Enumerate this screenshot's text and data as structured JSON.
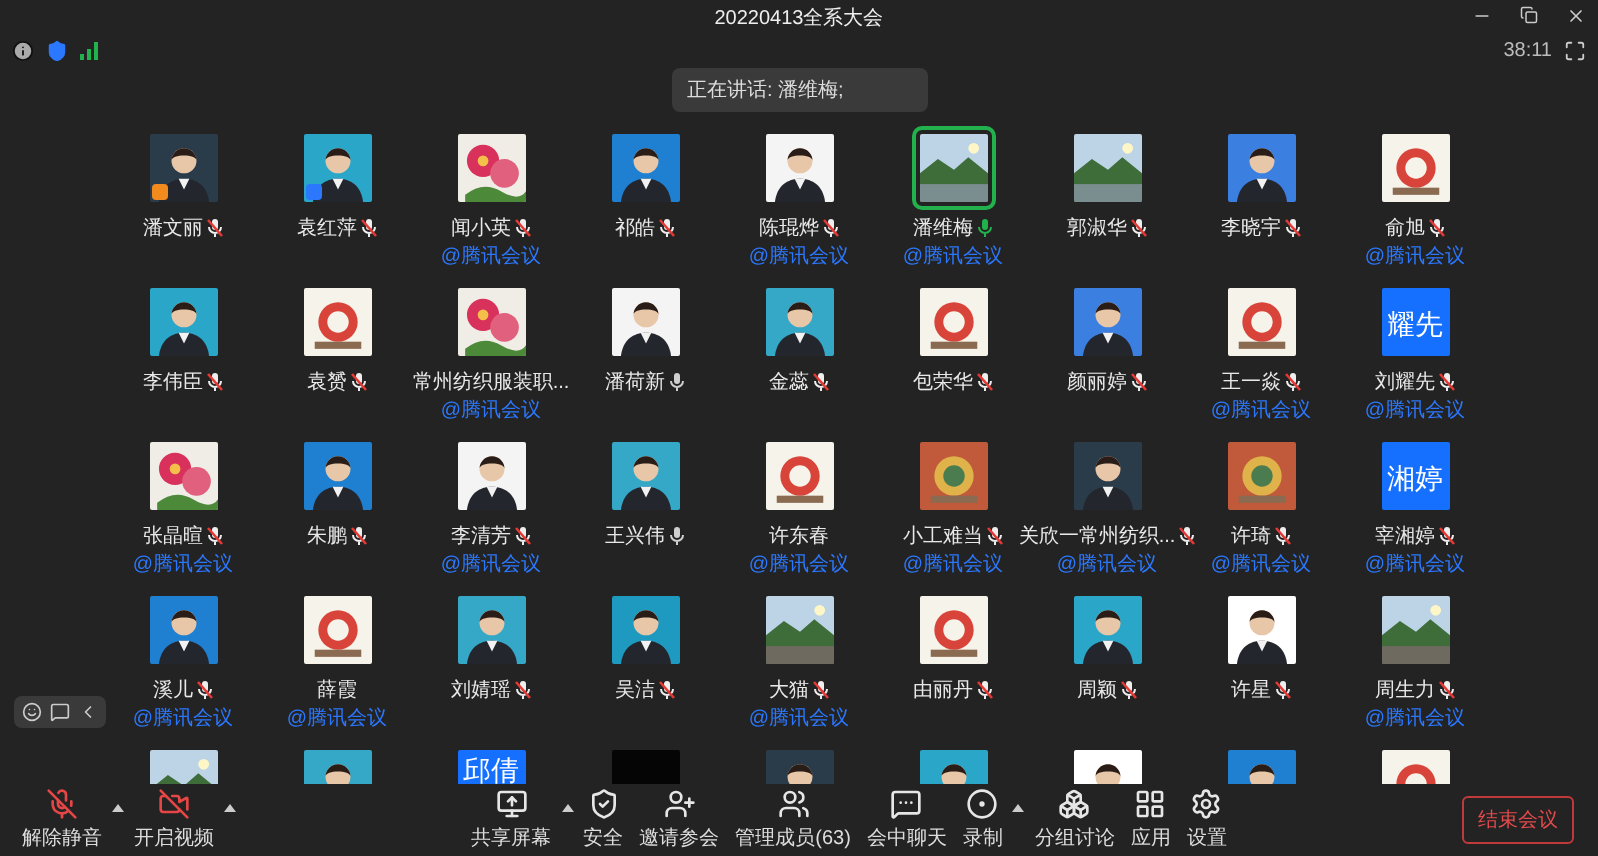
{
  "window": {
    "title": "20220413全系大会",
    "timer": "38:11"
  },
  "speaker_notice": "正在讲话: 潘维梅;",
  "participants": [
    {
      "name": "潘文丽",
      "muted": true,
      "speaking": false,
      "badge": {
        "color": "#f28a1e"
      },
      "active": false
    },
    {
      "name": "袁红萍",
      "muted": true,
      "speaking": false,
      "badge": {
        "color": "#2b78ff"
      },
      "active": false
    },
    {
      "name": "闻小英",
      "muted": true,
      "speaking": false,
      "label": "@腾讯会议",
      "active": false
    },
    {
      "name": "祁皓",
      "muted": true,
      "speaking": false,
      "active": false
    },
    {
      "name": "陈琨烨",
      "muted": true,
      "speaking": false,
      "label": "@腾讯会议",
      "active": false
    },
    {
      "name": "潘维梅",
      "muted": false,
      "speaking": true,
      "label": "@腾讯会议",
      "active": true
    },
    {
      "name": "郭淑华",
      "muted": true,
      "speaking": false,
      "active": false
    },
    {
      "name": "李晓宇",
      "muted": true,
      "speaking": false,
      "active": false
    },
    {
      "name": "俞旭",
      "muted": true,
      "speaking": false,
      "label": "@腾讯会议",
      "active": false
    },
    {
      "name": "李伟臣",
      "muted": true,
      "speaking": false,
      "active": false
    },
    {
      "name": "袁赟",
      "muted": true,
      "speaking": false,
      "active": false
    },
    {
      "name": "常州纺织服装职...",
      "label": "@腾讯会议",
      "active": false
    },
    {
      "name": "潘荷新",
      "muted": false,
      "speaking": false,
      "active": false
    },
    {
      "name": "金蕊",
      "muted": true,
      "speaking": false,
      "active": false
    },
    {
      "name": "包荣华",
      "muted": true,
      "speaking": false,
      "active": false
    },
    {
      "name": "颜丽婷",
      "muted": true,
      "speaking": false,
      "active": false
    },
    {
      "name": "王一焱",
      "muted": true,
      "speaking": false,
      "label": "@腾讯会议",
      "active": false
    },
    {
      "name": "刘耀先",
      "muted": true,
      "speaking": false,
      "label": "@腾讯会议",
      "avatar": {
        "kind": "text",
        "text": "耀先"
      },
      "active": false
    },
    {
      "name": "张晶暄",
      "muted": true,
      "speaking": false,
      "label": "@腾讯会议",
      "active": false
    },
    {
      "name": "朱鹏",
      "muted": true,
      "speaking": false,
      "active": false
    },
    {
      "name": "李清芳",
      "muted": true,
      "speaking": false,
      "label": "@腾讯会议",
      "active": false
    },
    {
      "name": "王兴伟",
      "muted": false,
      "speaking": false,
      "active": false
    },
    {
      "name": "许东春",
      "label": "@腾讯会议",
      "active": false
    },
    {
      "name": "小工难当",
      "muted": true,
      "speaking": false,
      "label": "@腾讯会议",
      "active": false
    },
    {
      "name": "关欣一常州纺织...",
      "muted": true,
      "speaking": false,
      "label": "@腾讯会议",
      "active": false
    },
    {
      "name": "许琦",
      "muted": true,
      "speaking": false,
      "label": "@腾讯会议",
      "active": false
    },
    {
      "name": "宰湘婷",
      "muted": true,
      "speaking": false,
      "label": "@腾讯会议",
      "avatar": {
        "kind": "text",
        "text": "湘婷"
      },
      "active": false
    },
    {
      "name": "溪儿",
      "muted": true,
      "speaking": false,
      "label": "@腾讯会议",
      "active": false
    },
    {
      "name": "薛霞",
      "label": "@腾讯会议",
      "active": false
    },
    {
      "name": "刘婧瑶",
      "muted": true,
      "speaking": false,
      "active": false
    },
    {
      "name": "吴洁",
      "muted": true,
      "speaking": false,
      "active": false
    },
    {
      "name": "大猫",
      "muted": true,
      "speaking": false,
      "label": "@腾讯会议",
      "active": false
    },
    {
      "name": "由丽丹",
      "muted": true,
      "speaking": false,
      "active": false
    },
    {
      "name": "周颖",
      "muted": true,
      "speaking": false,
      "active": false
    },
    {
      "name": "许星",
      "muted": true,
      "speaking": false,
      "active": false
    },
    {
      "name": "周生力",
      "muted": true,
      "speaking": false,
      "label": "@腾讯会议",
      "active": false
    },
    {
      "active": false
    },
    {
      "active": false
    },
    {
      "avatar": {
        "kind": "text",
        "text": "邱倩"
      },
      "active": false
    },
    {
      "active": false
    },
    {
      "active": false
    },
    {
      "active": false
    },
    {
      "active": false
    },
    {
      "active": false
    },
    {
      "active": false
    }
  ],
  "toolbar": {
    "left": [
      {
        "label": "解除静音",
        "menu": true
      },
      {
        "label": "开启视频",
        "menu": true
      }
    ],
    "center": [
      {
        "label": "共享屏幕",
        "menu": true
      },
      {
        "label": "安全",
        "menu": false
      },
      {
        "label": "邀请参会",
        "menu": false
      },
      {
        "label": "管理成员(63)",
        "menu": false
      },
      {
        "label": "会中聊天",
        "menu": false
      },
      {
        "label": "录制",
        "menu": true
      },
      {
        "label": "分组讨论",
        "menu": false
      },
      {
        "label": "应用",
        "menu": false
      },
      {
        "label": "设置",
        "menu": false
      }
    ],
    "end_button": "结束会议"
  }
}
